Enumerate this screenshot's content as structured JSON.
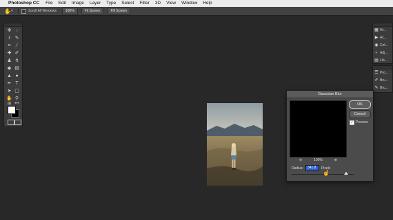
{
  "menubar": {
    "apple": "",
    "app_name": "Photoshop CC",
    "items": [
      "File",
      "Edit",
      "Image",
      "Layer",
      "Type",
      "Select",
      "Filter",
      "3D",
      "View",
      "Window",
      "Help"
    ]
  },
  "options_bar": {
    "scroll_all_windows": "Scroll All Windows",
    "zoom_100": "100%",
    "fit_screen": "Fit Screen",
    "fill_screen": "Fill Screen"
  },
  "right_panels": {
    "group1": [
      "Hi...",
      "Ac...",
      "Col...",
      "Adj...",
      "Lib..."
    ],
    "group2": [
      "Pro...",
      "Bru...",
      "Bru..."
    ]
  },
  "dialog": {
    "title": "Gaussian Blur",
    "ok_label": "OK",
    "cancel_label": "Cancel",
    "preview_label": "Preview",
    "preview_checked": true,
    "zoom_level": "100%",
    "radius_label": "Radius:",
    "radius_value": "341.8",
    "radius_unit": "Pixels",
    "slider_position": 0.88
  },
  "colors": {
    "workspace": "#282828",
    "panel": "#3c3c3c",
    "selection": "#2d5fd0"
  }
}
